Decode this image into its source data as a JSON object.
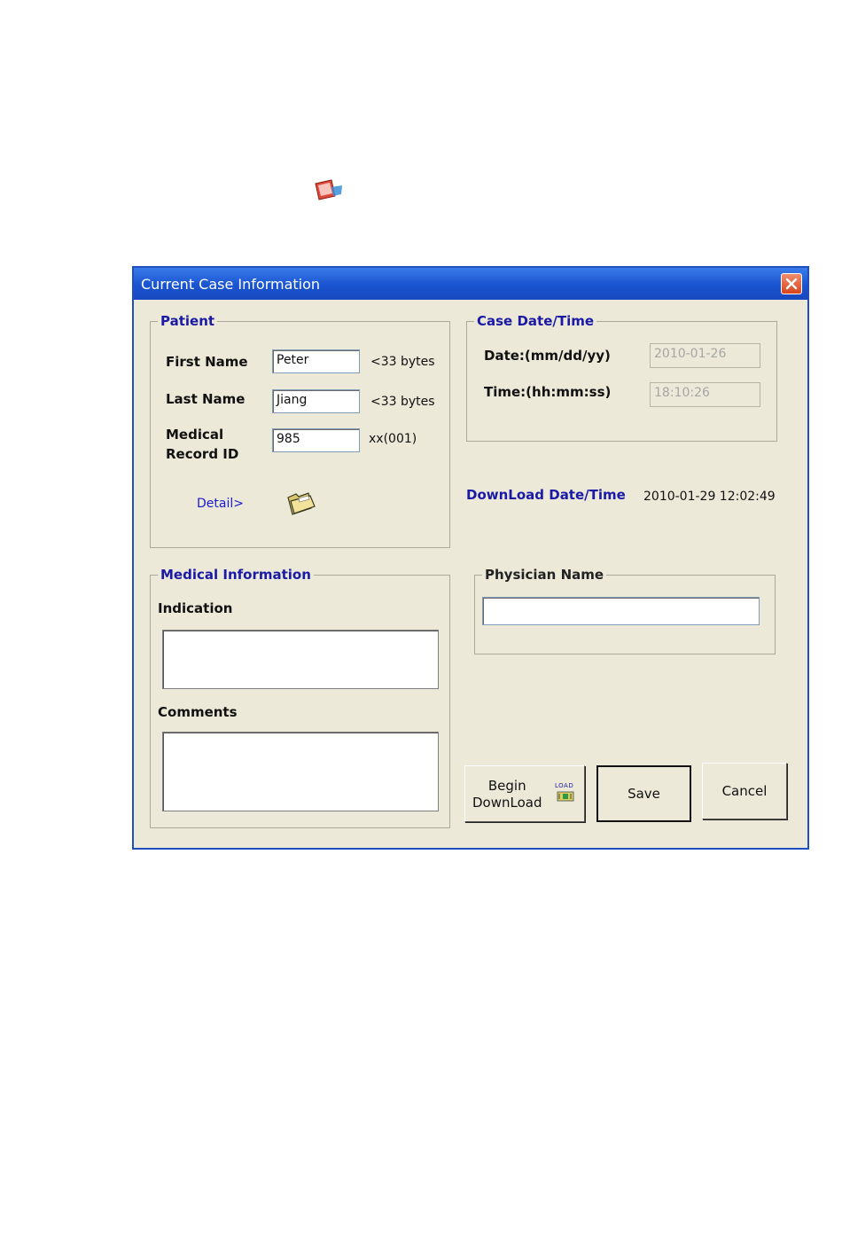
{
  "app_icon": "application-icon",
  "window": {
    "title": "Current Case Information",
    "close_icon": "close-icon"
  },
  "patient": {
    "legend": "Patient",
    "first_name_label": "First Name",
    "first_name_value": "Peter",
    "first_name_hint": "<33 bytes",
    "last_name_label": "Last Name",
    "last_name_value": "Jiang",
    "last_name_hint": "<33 bytes",
    "record_label_line1": "Medical",
    "record_label_line2": "Record ID",
    "record_value": "985",
    "record_hint": "xx(001)",
    "detail_link": "Detail>",
    "folder_icon": "folder-icon"
  },
  "case_datetime": {
    "legend": "Case Date/Time",
    "date_label": "Date:(mm/dd/yy)",
    "date_value": "2010-01-26",
    "time_label": "Time:(hh:mm:ss)",
    "time_value": "18:10:26"
  },
  "download": {
    "label": "DownLoad Date/Time",
    "value": "2010-01-29 12:02:49"
  },
  "medical": {
    "legend": "Medical Information",
    "indication_label": "Indication",
    "indication_value": "",
    "comments_label": "Comments",
    "comments_value": ""
  },
  "physician": {
    "legend": "Physician Name",
    "value": ""
  },
  "buttons": {
    "begin_line1": "Begin",
    "begin_line2": "DownLoad",
    "load_icon_text": "LOAD",
    "save": "Save",
    "cancel": "Cancel"
  },
  "colors": {
    "titlebar": "#1a54d0",
    "window_bg": "#ece9d8",
    "label_blue": "#1a1aa6"
  }
}
